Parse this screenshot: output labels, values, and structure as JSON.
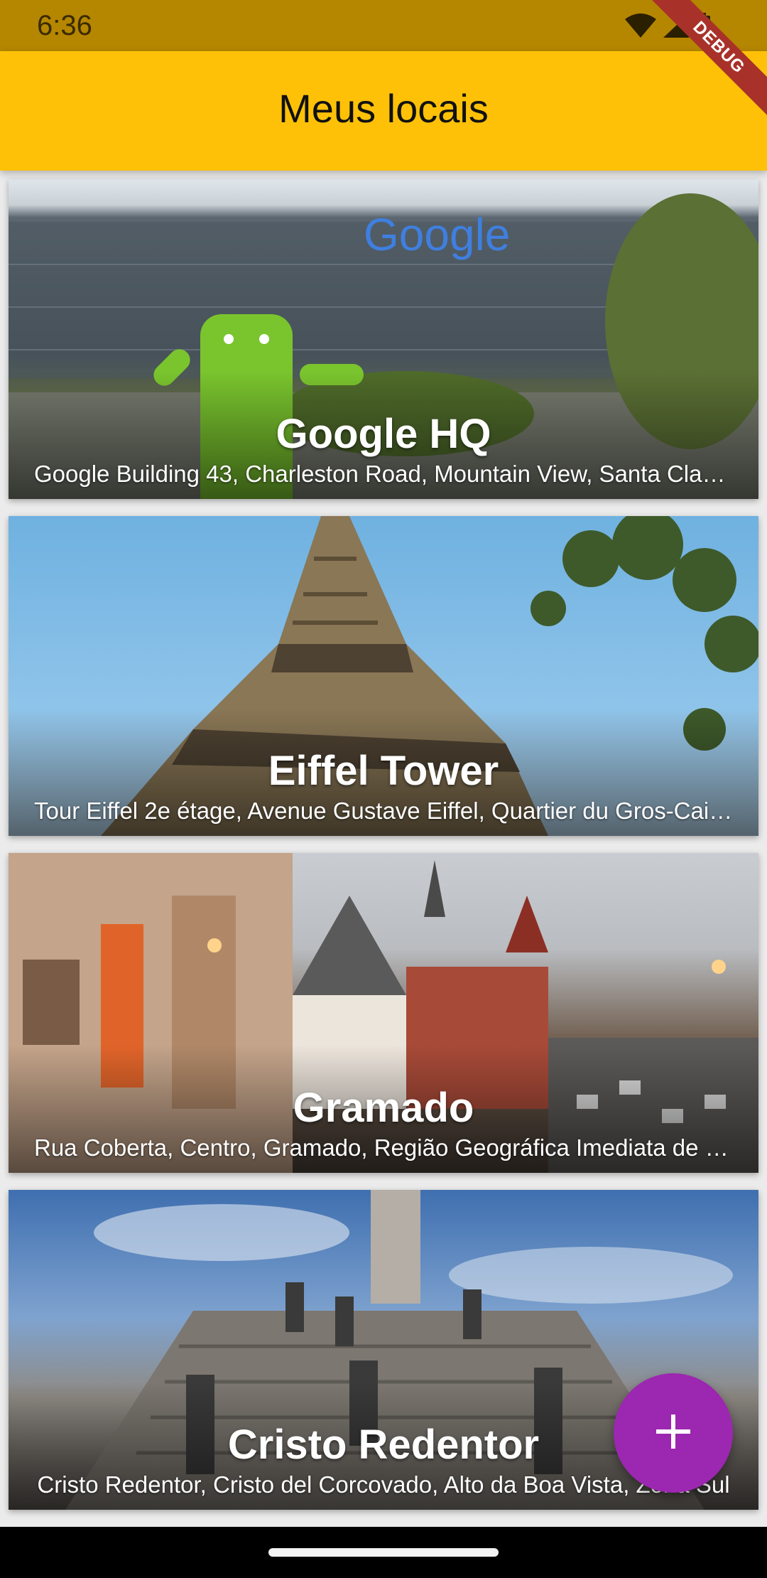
{
  "status_bar": {
    "time": "6:36"
  },
  "debug_banner": {
    "label": "DEBUG"
  },
  "app_bar": {
    "title": "Meus locais"
  },
  "places": [
    {
      "name": "Google HQ",
      "address": "Google Building 43, Charleston Road, Mountain View, Santa Clara County, California"
    },
    {
      "name": "Eiffel Tower",
      "address": "Tour Eiffel 2e étage, Avenue Gustave Eiffel, Quartier du Gros-Caillou, Paris"
    },
    {
      "name": "Gramado",
      "address": "Rua Coberta, Centro, Gramado, Região Geográfica Imediata de Caxias do Sul"
    },
    {
      "name": "Cristo Redentor",
      "address": "Cristo Redentor, Cristo del Corcovado, Alto da Boa Vista, Zona Sul"
    }
  ],
  "fab": {
    "icon": "plus-icon",
    "color": "#9c27b0"
  },
  "colors": {
    "app_bar": "#ffc107",
    "status_bar": "#b58600",
    "debug_banner": "#a8322a"
  }
}
